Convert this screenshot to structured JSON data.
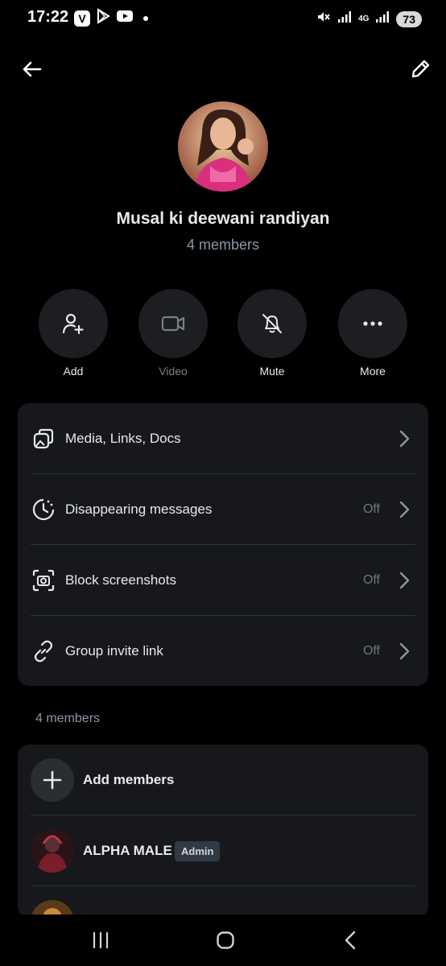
{
  "status_bar": {
    "time": "17:22",
    "left_icons": [
      "v-app-icon",
      "play-store-icon",
      "youtube-icon",
      "notification-dot"
    ],
    "right_icons": [
      "mute-icon",
      "signal-icon",
      "4g-icon",
      "signal-icon"
    ],
    "network": "4G",
    "battery": "73"
  },
  "header": {
    "back_icon": "back-arrow-icon",
    "edit_icon": "pencil-icon"
  },
  "group": {
    "name": "Musal ki deewani randiyan",
    "member_count": "4 members"
  },
  "actions": [
    {
      "label": "Add",
      "icon": "add-person-icon"
    },
    {
      "label": "Video",
      "icon": "video-camera-icon"
    },
    {
      "label": "Mute",
      "icon": "bell-off-icon"
    },
    {
      "label": "More",
      "icon": "more-dots-icon"
    }
  ],
  "settings": [
    {
      "label": "Media, Links, Docs",
      "value": "",
      "icon": "media-stack-icon"
    },
    {
      "label": "Disappearing messages",
      "value": "Off",
      "icon": "timer-icon"
    },
    {
      "label": "Block screenshots",
      "value": "Off",
      "icon": "screenshot-camera-icon"
    },
    {
      "label": "Group invite link",
      "value": "Off",
      "icon": "link-icon"
    }
  ],
  "members_section": {
    "heading": "4 members",
    "add_label": "Add members",
    "members": [
      {
        "name": "ALPHA MALE",
        "badge": "Admin"
      }
    ]
  },
  "colors": {
    "background": "#000000",
    "card": "#16181c",
    "text": "#e7e9ea",
    "muted": "#71767b",
    "badge": "#2f3a44"
  }
}
